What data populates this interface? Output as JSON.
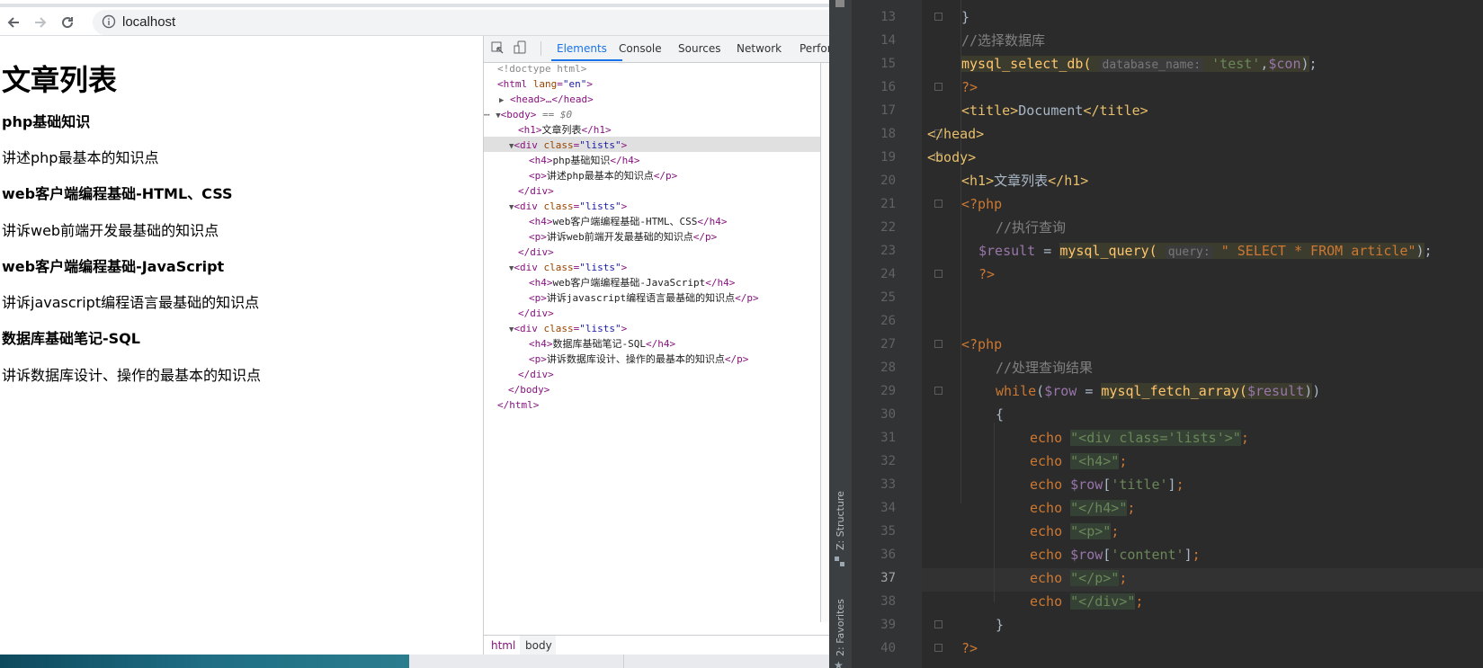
{
  "browser": {
    "url": "localhost",
    "page": {
      "title": "文章列表",
      "articles": [
        {
          "title": "php基础知识",
          "content": "讲述php最基本的知识点"
        },
        {
          "title": "web客户端编程基础-HTML、CSS",
          "content": "讲诉web前端开发最基础的知识点"
        },
        {
          "title": "web客户端编程基础-JavaScript",
          "content": "讲诉javascript编程语言最基础的知识点"
        },
        {
          "title": "数据库基础笔记-SQL",
          "content": "讲诉数据库设计、操作的最基本的知识点"
        }
      ]
    }
  },
  "devtools": {
    "tabs": [
      "Elements",
      "Console",
      "Sources",
      "Network",
      "Perfor"
    ],
    "active_tab": "Elements",
    "tree": {
      "doctype": "<!doctype html>",
      "html_open": "<html lang=\"en\">",
      "head": "<head>…</head>",
      "body_open": "<body>",
      "body_marker": " == $0",
      "h1": "文章列表",
      "div_class": "lists",
      "body_close": "</body>",
      "html_close": "</html>"
    },
    "breadcrumbs": [
      "html",
      "body"
    ]
  },
  "ide": {
    "tool_windows": [
      "Z: Structure",
      "2: Favorites"
    ],
    "line_numbers": [
      "13",
      "14",
      "15",
      "16",
      "17",
      "18",
      "19",
      "20",
      "21",
      "22",
      "23",
      "24",
      "25",
      "26",
      "27",
      "28",
      "29",
      "30",
      "31",
      "32",
      "33",
      "34",
      "35",
      "36",
      "37",
      "38",
      "39",
      "40"
    ],
    "current_line": "37",
    "code": {
      "l14_comment": "//选择数据库",
      "l15_func": "mysql_select_db(",
      "l15_hint": "database_name:",
      "l15_arg": "'test'",
      "l15_var": "$con",
      "l17_title_text": "Document",
      "l20_h1_text": "文章列表",
      "l22_comment": "//执行查询",
      "l23_var": "$result",
      "l23_func": "mysql_query(",
      "l23_hint": "query:",
      "l23_sql": "\" SELECT * FROM article\"",
      "l28_comment": "//处理查询结果",
      "l29_var": "$row",
      "l29_func": "mysql_fetch_array(",
      "l29_arg": "$result",
      "echo_div_open": "\"<div class='lists'>\"",
      "echo_h4_open": "\"<h4>\"",
      "row_title": "'title'",
      "echo_h4_close": "\"</h4>\"",
      "echo_p_open": "\"<p>\"",
      "row_content": "'content'",
      "echo_p_close": "\"</p>\"",
      "echo_div_close": "\"</div>\""
    }
  },
  "colors": {
    "ide_bg": "#2b2b2b",
    "keyword": "#cc7832",
    "string": "#6a8759",
    "variable": "#9876aa",
    "function": "#ffc66d",
    "devtools_accent": "#1a73e8"
  }
}
